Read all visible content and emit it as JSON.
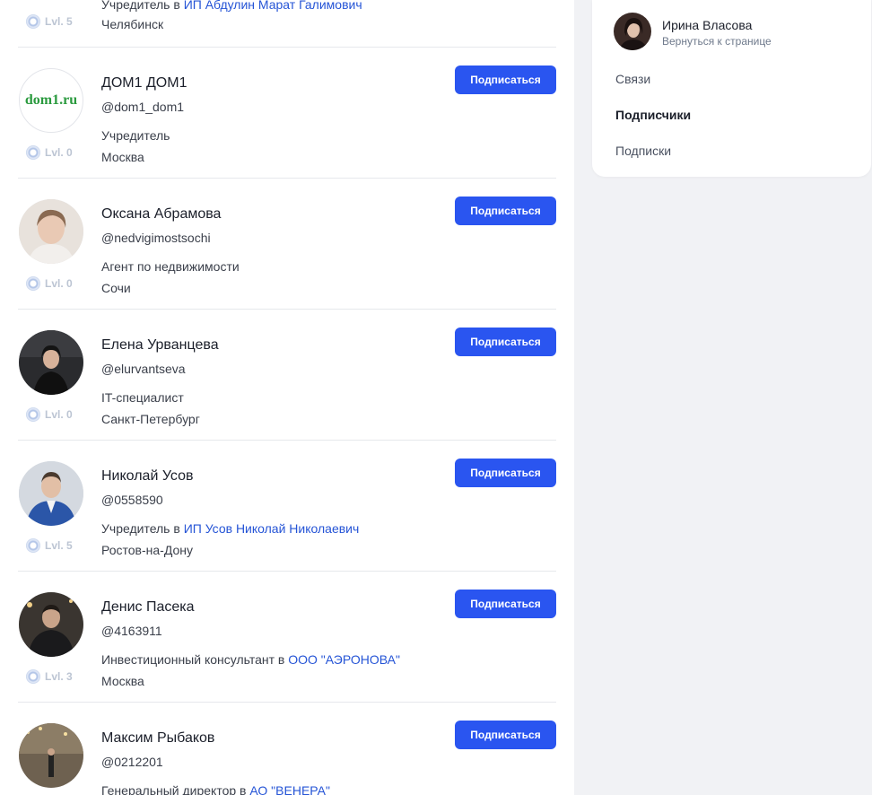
{
  "list": {
    "first_partial": {
      "job_prefix": "Учредитель в ",
      "job_company": "ИП Абдулин Марат Галимович",
      "city": "Челябинск",
      "level": "Lvl. 5"
    },
    "items": [
      {
        "name": "ДОМ1 ДОМ1",
        "handle": "@dom1_dom1",
        "job_prefix": "Учредитель",
        "job_company": "",
        "city": "Москва",
        "level": "Lvl. 0",
        "avatar_logo": "dom1.ru",
        "subscribe_label": "Подписаться"
      },
      {
        "name": "Оксана Абрамова",
        "handle": "@nedvigimostsochi",
        "job_prefix": "Агент по недвижимости",
        "job_company": "",
        "city": "Сочи",
        "level": "Lvl. 0",
        "subscribe_label": "Подписаться"
      },
      {
        "name": "Елена Урванцева",
        "handle": "@elurvantseva",
        "job_prefix": "IT-специалист",
        "job_company": "",
        "city": "Санкт-Петербург",
        "level": "Lvl. 0",
        "subscribe_label": "Подписаться"
      },
      {
        "name": "Николай Усов",
        "handle": "@0558590",
        "job_prefix": "Учредитель в ",
        "job_company": "ИП Усов Николай Николаевич",
        "city": "Ростов-на-Дону",
        "level": "Lvl. 5",
        "subscribe_label": "Подписаться"
      },
      {
        "name": "Денис Пасека",
        "handle": "@4163911",
        "job_prefix": "Инвестиционный консультант в ",
        "job_company": "ООО \"АЭРОНОВА\"",
        "city": "Москва",
        "level": "Lvl. 3",
        "subscribe_label": "Подписаться"
      },
      {
        "name": "Максим Рыбаков",
        "handle": "@0212201",
        "job_prefix": "Генеральный директор в ",
        "job_company": "АО \"ВЕНЕРА\"",
        "city": "",
        "level": "",
        "subscribe_label": "Подписаться"
      }
    ]
  },
  "sidebar": {
    "profile_name": "Ирина Власова",
    "back_link": "Вернуться к странице",
    "nav": [
      {
        "label": "Связи",
        "active": false
      },
      {
        "label": "Подписчики",
        "active": true
      },
      {
        "label": "Подписки",
        "active": false
      }
    ]
  },
  "colors": {
    "accent": "#2a55f0",
    "link": "#2554d6",
    "level_text": "#bcc5d3"
  }
}
